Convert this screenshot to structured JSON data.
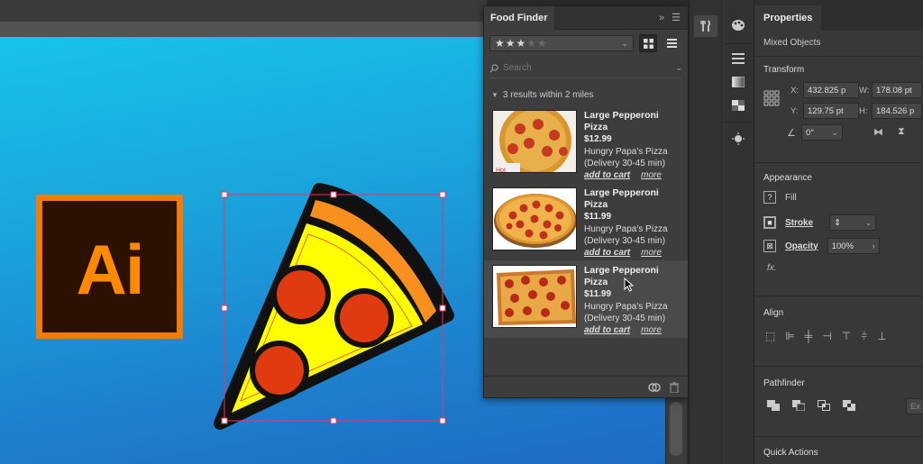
{
  "artwork": {
    "logo_text": "Ai"
  },
  "food_finder": {
    "tab_title": "Food Finder",
    "header_buttons": [
      "»",
      "☰"
    ],
    "rating": {
      "stars_filled": 3,
      "stars_total": 5
    },
    "search_placeholder": "Search",
    "results_summary": "3 results within 2 miles",
    "results": [
      {
        "title": "Large Pepperoni Pizza",
        "price": "$12.99",
        "vendor": "Hungry Papa's Pizza",
        "delivery": "(Delivery 30-45 min)",
        "add_label": "add to cart",
        "more_label": "more",
        "selected": false
      },
      {
        "title": "Large Pepperoni Pizza",
        "price": "$11.99",
        "vendor": "Hungry Papa's Pizza",
        "delivery": "(Delivery 30-45 min)",
        "add_label": "add to cart",
        "more_label": "more",
        "selected": false
      },
      {
        "title": "Large Pepperoni Pizza",
        "price": "$11.99",
        "vendor": "Hungry Papa's Pizza",
        "delivery": "(Delivery 30-45 min)",
        "add_label": "add to cart",
        "more_label": "more",
        "selected": true
      }
    ]
  },
  "properties": {
    "tab_title": "Properties",
    "selection_type": "Mixed Objects",
    "transform": {
      "title": "Transform",
      "x_label": "X:",
      "x_value": "432.825 p",
      "y_label": "Y:",
      "y_value": "129.75 pt",
      "w_label": "W:",
      "w_value": "178.08 pt",
      "h_label": "H:",
      "h_value": "184.526 p",
      "angle_value": "0°"
    },
    "appearance": {
      "title": "Appearance",
      "fill_label": "Fill",
      "stroke_label": "Stroke",
      "opacity_label": "Opacity",
      "opacity_value": "100%",
      "fx_label": "fx."
    },
    "align_title": "Align",
    "pathfinder_title": "Pathfinder",
    "expand_label": "Ex",
    "quick_actions_title": "Quick Actions"
  },
  "colors": {
    "artboard_top": "#17c3e8",
    "artboard_bottom": "#1f6bc4",
    "ai_orange": "#f57c00",
    "pizza_cheese": "#ffff00",
    "pizza_crust": "#f7901e",
    "pepperoni": "#e03a10",
    "selection": "#e8375a"
  }
}
